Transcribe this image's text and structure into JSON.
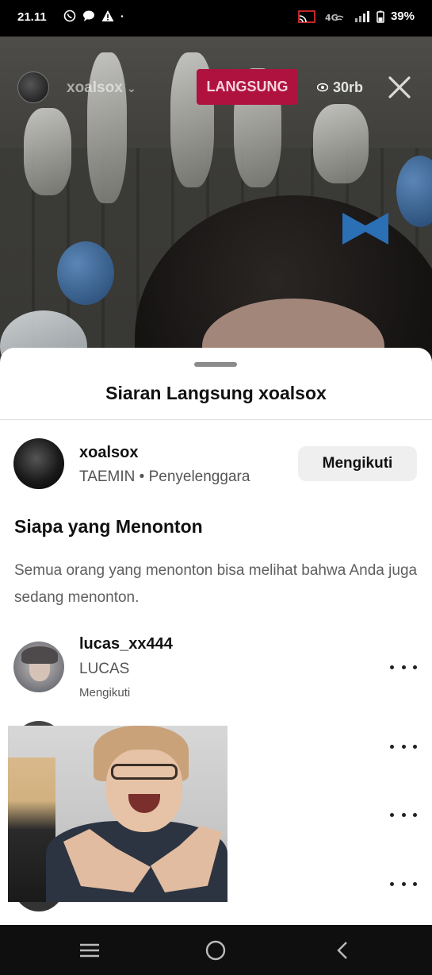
{
  "status_bar": {
    "time": "21.11",
    "battery": "39%",
    "notification_icons": [
      "whatsapp-icon",
      "message-icon",
      "warning-icon",
      "dot-icon"
    ],
    "system_icons": [
      "cast-icon",
      "wifi-icon",
      "signal-icon",
      "battery-icon"
    ]
  },
  "live": {
    "host_username": "xoalsox",
    "badge": "LANGSUNG",
    "viewer_count": "30rb"
  },
  "sheet": {
    "title": "Siaran Langsung xoalsox",
    "host": {
      "username": "xoalsox",
      "subtitle": "TAEMIN • Penyelenggara",
      "follow_label": "Mengikuti"
    },
    "section_title": "Siapa yang Menonton",
    "section_desc": "Semua orang yang menonton bisa melihat bahwa Anda juga sedang menonton.",
    "viewers": [
      {
        "username": "lucas_xx444",
        "name": "LUCAS",
        "status": "Mengikuti"
      }
    ]
  },
  "nav": {
    "icons": [
      "recent-apps-icon",
      "home-icon",
      "back-icon"
    ]
  },
  "colors": {
    "live_red": "#b0123f",
    "button_gray": "#efefef"
  }
}
